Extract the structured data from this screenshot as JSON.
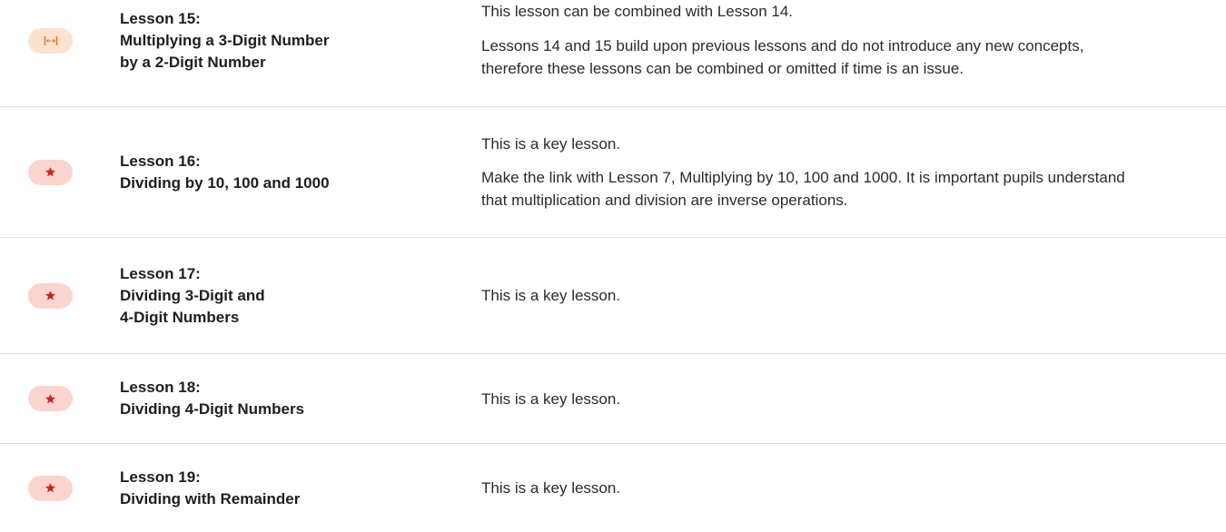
{
  "colors": {
    "star_badge_bg": "#fbd3cf",
    "star_icon": "#c62828",
    "stretch_badge_bg": "#fde2cf",
    "stretch_icon": "#e07a2e",
    "divider": "#dcdcdc"
  },
  "lessons": [
    {
      "icon": "stretch-icon",
      "title_line1": "Lesson 15:",
      "title_line2": "Multiplying a 3-Digit Number",
      "title_line3": "by a 2-Digit Number",
      "note1": "This lesson can be combined with Lesson 14.",
      "note2": "Lessons 14 and 15 build upon previous lessons and do not introduce any new concepts, therefore these lessons can be combined or omitted if time is an issue."
    },
    {
      "icon": "star-icon",
      "title_line1": "Lesson 16:",
      "title_line2": "Dividing by 10, 100 and 1000",
      "note1": "This is a key lesson.",
      "note2": "Make the link with Lesson 7, Multiplying by 10, 100 and 1000. It is important pupils understand that multiplication and division are inverse operations."
    },
    {
      "icon": "star-icon",
      "title_line1": "Lesson 17:",
      "title_line2": "Dividing 3-Digit and",
      "title_line3": "4-Digit Numbers",
      "note1": "This is a key lesson."
    },
    {
      "icon": "star-icon",
      "title_line1": "Lesson 18:",
      "title_line2": "Dividing 4-Digit Numbers",
      "note1": "This is a key lesson."
    },
    {
      "icon": "star-icon",
      "title_line1": "Lesson 19:",
      "title_line2": "Dividing with Remainder",
      "note1": "This is a key lesson."
    }
  ]
}
